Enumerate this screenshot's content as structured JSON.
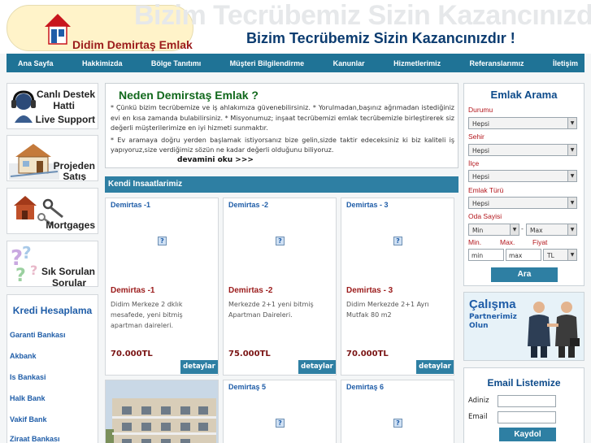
{
  "header": {
    "logo_text": "Didim Demirtaş Emlak",
    "slogan_bg": "Bizim Tecrübemiz Sizin Kazancınızdır !",
    "slogan": "Bizim Tecrübemiz Sizin Kazancınızdır !"
  },
  "nav": [
    "Ana Sayfa",
    "Hakkimizda",
    "Bölge Tanıtımı",
    "Müşteri Bilgilendirme",
    "Kanunlar",
    "Hizmetlerimiz",
    "Referanslarımız",
    "İletişim"
  ],
  "left_boxes": [
    {
      "lines": [
        "Canlı Destek",
        "Hatti",
        "Live Support"
      ],
      "icon": "headset-icon"
    },
    {
      "lines": [
        "Projeden",
        "Satış"
      ],
      "icon": "house-project-icon"
    },
    {
      "lines": [
        "Mortgages"
      ],
      "icon": "house-keys-icon"
    },
    {
      "lines": [
        "Sık Sorulan",
        "Sorular"
      ],
      "icon": "question-marks-icon"
    }
  ],
  "kredi": {
    "title": "Kredi Hesaplama",
    "banks": [
      "Garanti Bankası",
      "Akbank",
      "Is Bankasi",
      "Halk Bank",
      "Vakif Bank",
      "Ziraat Bankası"
    ]
  },
  "neden": {
    "title": "Neden Demirstaş Emlak ?",
    "text": "* Çünkü bizim tecrübemize ve iş ahlakımıza güvenebilirsiniz. * Yorulmadan,başınız ağrımadan istediğiniz evi en kısa zamanda bulabilirsiniz. * Misyonumuz; inşaat tecrübemizi emlak tecrübemizle birleştirerek siz değerli müşterilerimize en iyi hizmeti sunmaktır.",
    "text2": "* Ev aramaya doğru yerden başlamak istiyorsanız bize gelin,sizde taktir edeceksiniz ki biz kaliteli iş yapıyoruz,size verdiğimiz sözün ne kadar değerli olduğunu biliyoruz.",
    "more": "devamini oku >>>"
  },
  "section_title": "Kendi Insaatlarimiz",
  "cards": [
    {
      "title": "Demirtas -1",
      "name": "Demirtas -1",
      "desc": "Didim Merkeze 2 dklık mesafede, yeni bitmiş apartman daireleri.",
      "price": "70.000TL",
      "btn": "detaylar"
    },
    {
      "title": "Demirtas -2",
      "name": "Demirtas -2",
      "desc": "Merkezde 2+1 yeni bitmiş Apartman Daireleri.",
      "price": "75.000TL",
      "btn": "detaylar"
    },
    {
      "title": "Demirtas - 3",
      "name": "Demirtas - 3",
      "desc": "Didim Merkezde 2+1 Ayrı Mutfak 80 m2",
      "price": "70.000TL",
      "btn": "detaylar"
    },
    {
      "title": "Demirtaş 5"
    },
    {
      "title": "Demirtaş 6"
    }
  ],
  "arama": {
    "title": "Emlak Arama",
    "durum_label": "Durumu",
    "durum": "Hepsi",
    "sehir_label": "Sehir",
    "sehir": "Hepsi",
    "ilce_label": "İlçe",
    "ilce": "Hepsi",
    "tur_label": "Emlak Türü",
    "tur": "Hepsi",
    "oda_label": "Oda Sayisi",
    "oda_min": "Min",
    "oda_max": "Max",
    "min_label": "Min.",
    "max_label": "Max.",
    "fiyat_label": "Fiyat",
    "min_ph": "min",
    "max_ph": "max",
    "currency": "TL",
    "btn": "Ara"
  },
  "calisma": {
    "title": "Çalışma",
    "sub1": "Partnerimiz",
    "sub2": "Olun"
  },
  "email": {
    "title": "Email Listemize",
    "adiniz": "Adiniz",
    "email": "Email",
    "btn": "Kaydol"
  }
}
